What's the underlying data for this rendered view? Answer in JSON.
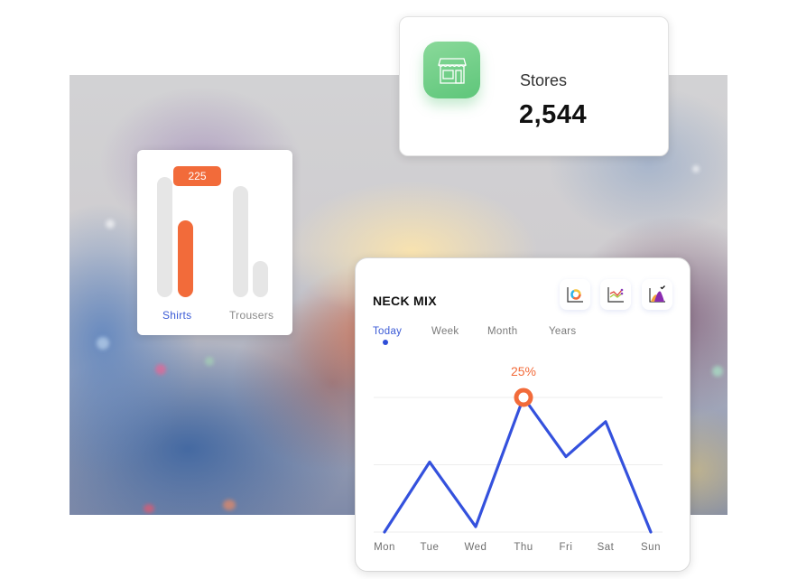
{
  "stores_card": {
    "icon": "storefront-icon",
    "label": "Stores",
    "value": "2,544",
    "icon_color": "#6fcf86"
  },
  "bar_card": {
    "badge_value": "225",
    "items": [
      {
        "label": "Shirts",
        "active": true,
        "track_fraction": 0.85,
        "value_fraction": 0.55
      },
      {
        "label": "Trousers",
        "active": false,
        "track_fraction": 0.78,
        "value_fraction": 0.26
      }
    ],
    "accent_color": "#f26b3a",
    "active_label_color": "#3a5ad6"
  },
  "neck_mix": {
    "title": "NECK MIX",
    "chart_type_buttons": [
      {
        "name": "donut-chart-icon",
        "selected": false
      },
      {
        "name": "line-chart-icon",
        "selected": false
      },
      {
        "name": "area-chart-icon",
        "selected": true
      }
    ],
    "tabs": [
      {
        "label": "Today",
        "active": true
      },
      {
        "label": "Week",
        "active": false
      },
      {
        "label": "Month",
        "active": false
      },
      {
        "label": "Years",
        "active": false
      }
    ],
    "line_color": "#3451dd",
    "highlight_color": "#f26b3a"
  },
  "chart_data": {
    "type": "line",
    "title": "NECK MIX",
    "categories": [
      "Mon",
      "Tue",
      "Wed",
      "Thu",
      "Fri",
      "Sat",
      "Sun"
    ],
    "series": [
      {
        "name": "Today",
        "values": [
          0,
          13,
          1,
          25,
          14,
          20.5,
          0
        ]
      }
    ],
    "highlight": {
      "category": "Thu",
      "label": "25%"
    },
    "ylim": [
      0,
      25
    ],
    "gridlines": [
      0,
      12.5,
      25
    ],
    "grid": true,
    "xlabel": "",
    "ylabel": ""
  }
}
